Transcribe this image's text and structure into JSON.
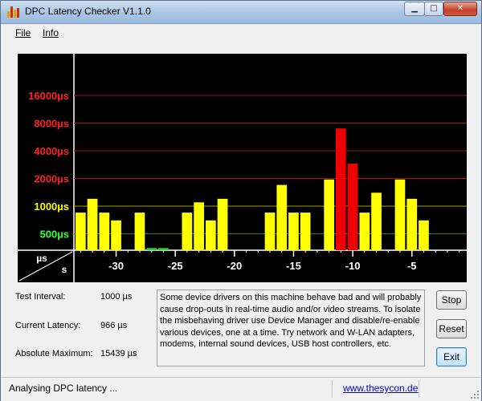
{
  "window": {
    "title": "DPC Latency Checker V1.1.0"
  },
  "menu": {
    "file": "File",
    "info": "Info"
  },
  "chart_data": {
    "type": "bar",
    "y_scale": "log",
    "axis_corner": {
      "top": "µs",
      "bottom": "s"
    },
    "y_ticks": [
      {
        "label": "16000µs",
        "value": 16000,
        "color": "#ff2020"
      },
      {
        "label": "8000µs",
        "value": 8000,
        "color": "#ff2020"
      },
      {
        "label": "4000µs",
        "value": 4000,
        "color": "#ff2020"
      },
      {
        "label": "2000µs",
        "value": 2000,
        "color": "#ff2020"
      },
      {
        "label": "1000µs",
        "value": 1000,
        "color": "#ffff00"
      },
      {
        "label": "500µs",
        "value": 500,
        "color": "#33ff33"
      }
    ],
    "x_ticks": [
      {
        "label": "-30",
        "value": -30
      },
      {
        "label": "-25",
        "value": -25
      },
      {
        "label": "-20",
        "value": -20
      },
      {
        "label": "-15",
        "value": -15
      },
      {
        "label": "-10",
        "value": -10
      },
      {
        "label": "-5",
        "value": -5
      }
    ],
    "x_range": [
      -33,
      -1
    ],
    "bars": [
      {
        "x": -33,
        "value": 850
      },
      {
        "x": -32,
        "value": 1200
      },
      {
        "x": -31,
        "value": 850
      },
      {
        "x": -30,
        "value": 700
      },
      {
        "x": -29,
        "value": 330
      },
      {
        "x": -28,
        "value": 850
      },
      {
        "x": -27,
        "value": 350
      },
      {
        "x": -26,
        "value": 350
      },
      {
        "x": -25,
        "value": 330
      },
      {
        "x": -24,
        "value": 850
      },
      {
        "x": -23,
        "value": 1100
      },
      {
        "x": -22,
        "value": 700
      },
      {
        "x": -21,
        "value": 1200
      },
      {
        "x": -20,
        "value": 330
      },
      {
        "x": -19,
        "value": 330
      },
      {
        "x": -18,
        "value": 330
      },
      {
        "x": -17,
        "value": 850
      },
      {
        "x": -16,
        "value": 1700
      },
      {
        "x": -15,
        "value": 850
      },
      {
        "x": -14,
        "value": 850
      },
      {
        "x": -13,
        "value": 330
      },
      {
        "x": -12,
        "value": 1950
      },
      {
        "x": -11,
        "value": 7000
      },
      {
        "x": -10,
        "value": 2900
      },
      {
        "x": -9,
        "value": 850
      },
      {
        "x": -8,
        "value": 1400
      },
      {
        "x": -7,
        "value": 330
      },
      {
        "x": -6,
        "value": 1950
      },
      {
        "x": -5,
        "value": 1200
      },
      {
        "x": -4,
        "value": 700
      },
      {
        "x": -3,
        "value": 330
      },
      {
        "x": -2,
        "value": 330
      },
      {
        "x": -1,
        "value": 330
      }
    ],
    "colors": {
      "green": "#22dd22",
      "yellow": "#ffff00",
      "red": "#ee0000",
      "grid": "#b01010",
      "background": "#000000"
    }
  },
  "info": {
    "test_interval_label": "Test Interval:",
    "test_interval_value": "1000 µs",
    "current_latency_label": "Current Latency:",
    "current_latency_value": "966 µs",
    "absolute_max_label": "Absolute Maximum:",
    "absolute_max_value": "15439 µs"
  },
  "description": "Some device drivers on this machine behave bad and will probably cause drop-outs in real-time audio and/or video streams. To isolate the misbehaving driver use Device Manager and disable/re-enable various devices, one at a time. Try network and W-LAN adapters, modems, internal sound devices, USB host controllers, etc.",
  "buttons": {
    "stop": "Stop",
    "reset": "Reset",
    "exit": "Exit"
  },
  "status": {
    "text": "Analysing DPC latency ...",
    "link": "www.thesycon.de"
  }
}
